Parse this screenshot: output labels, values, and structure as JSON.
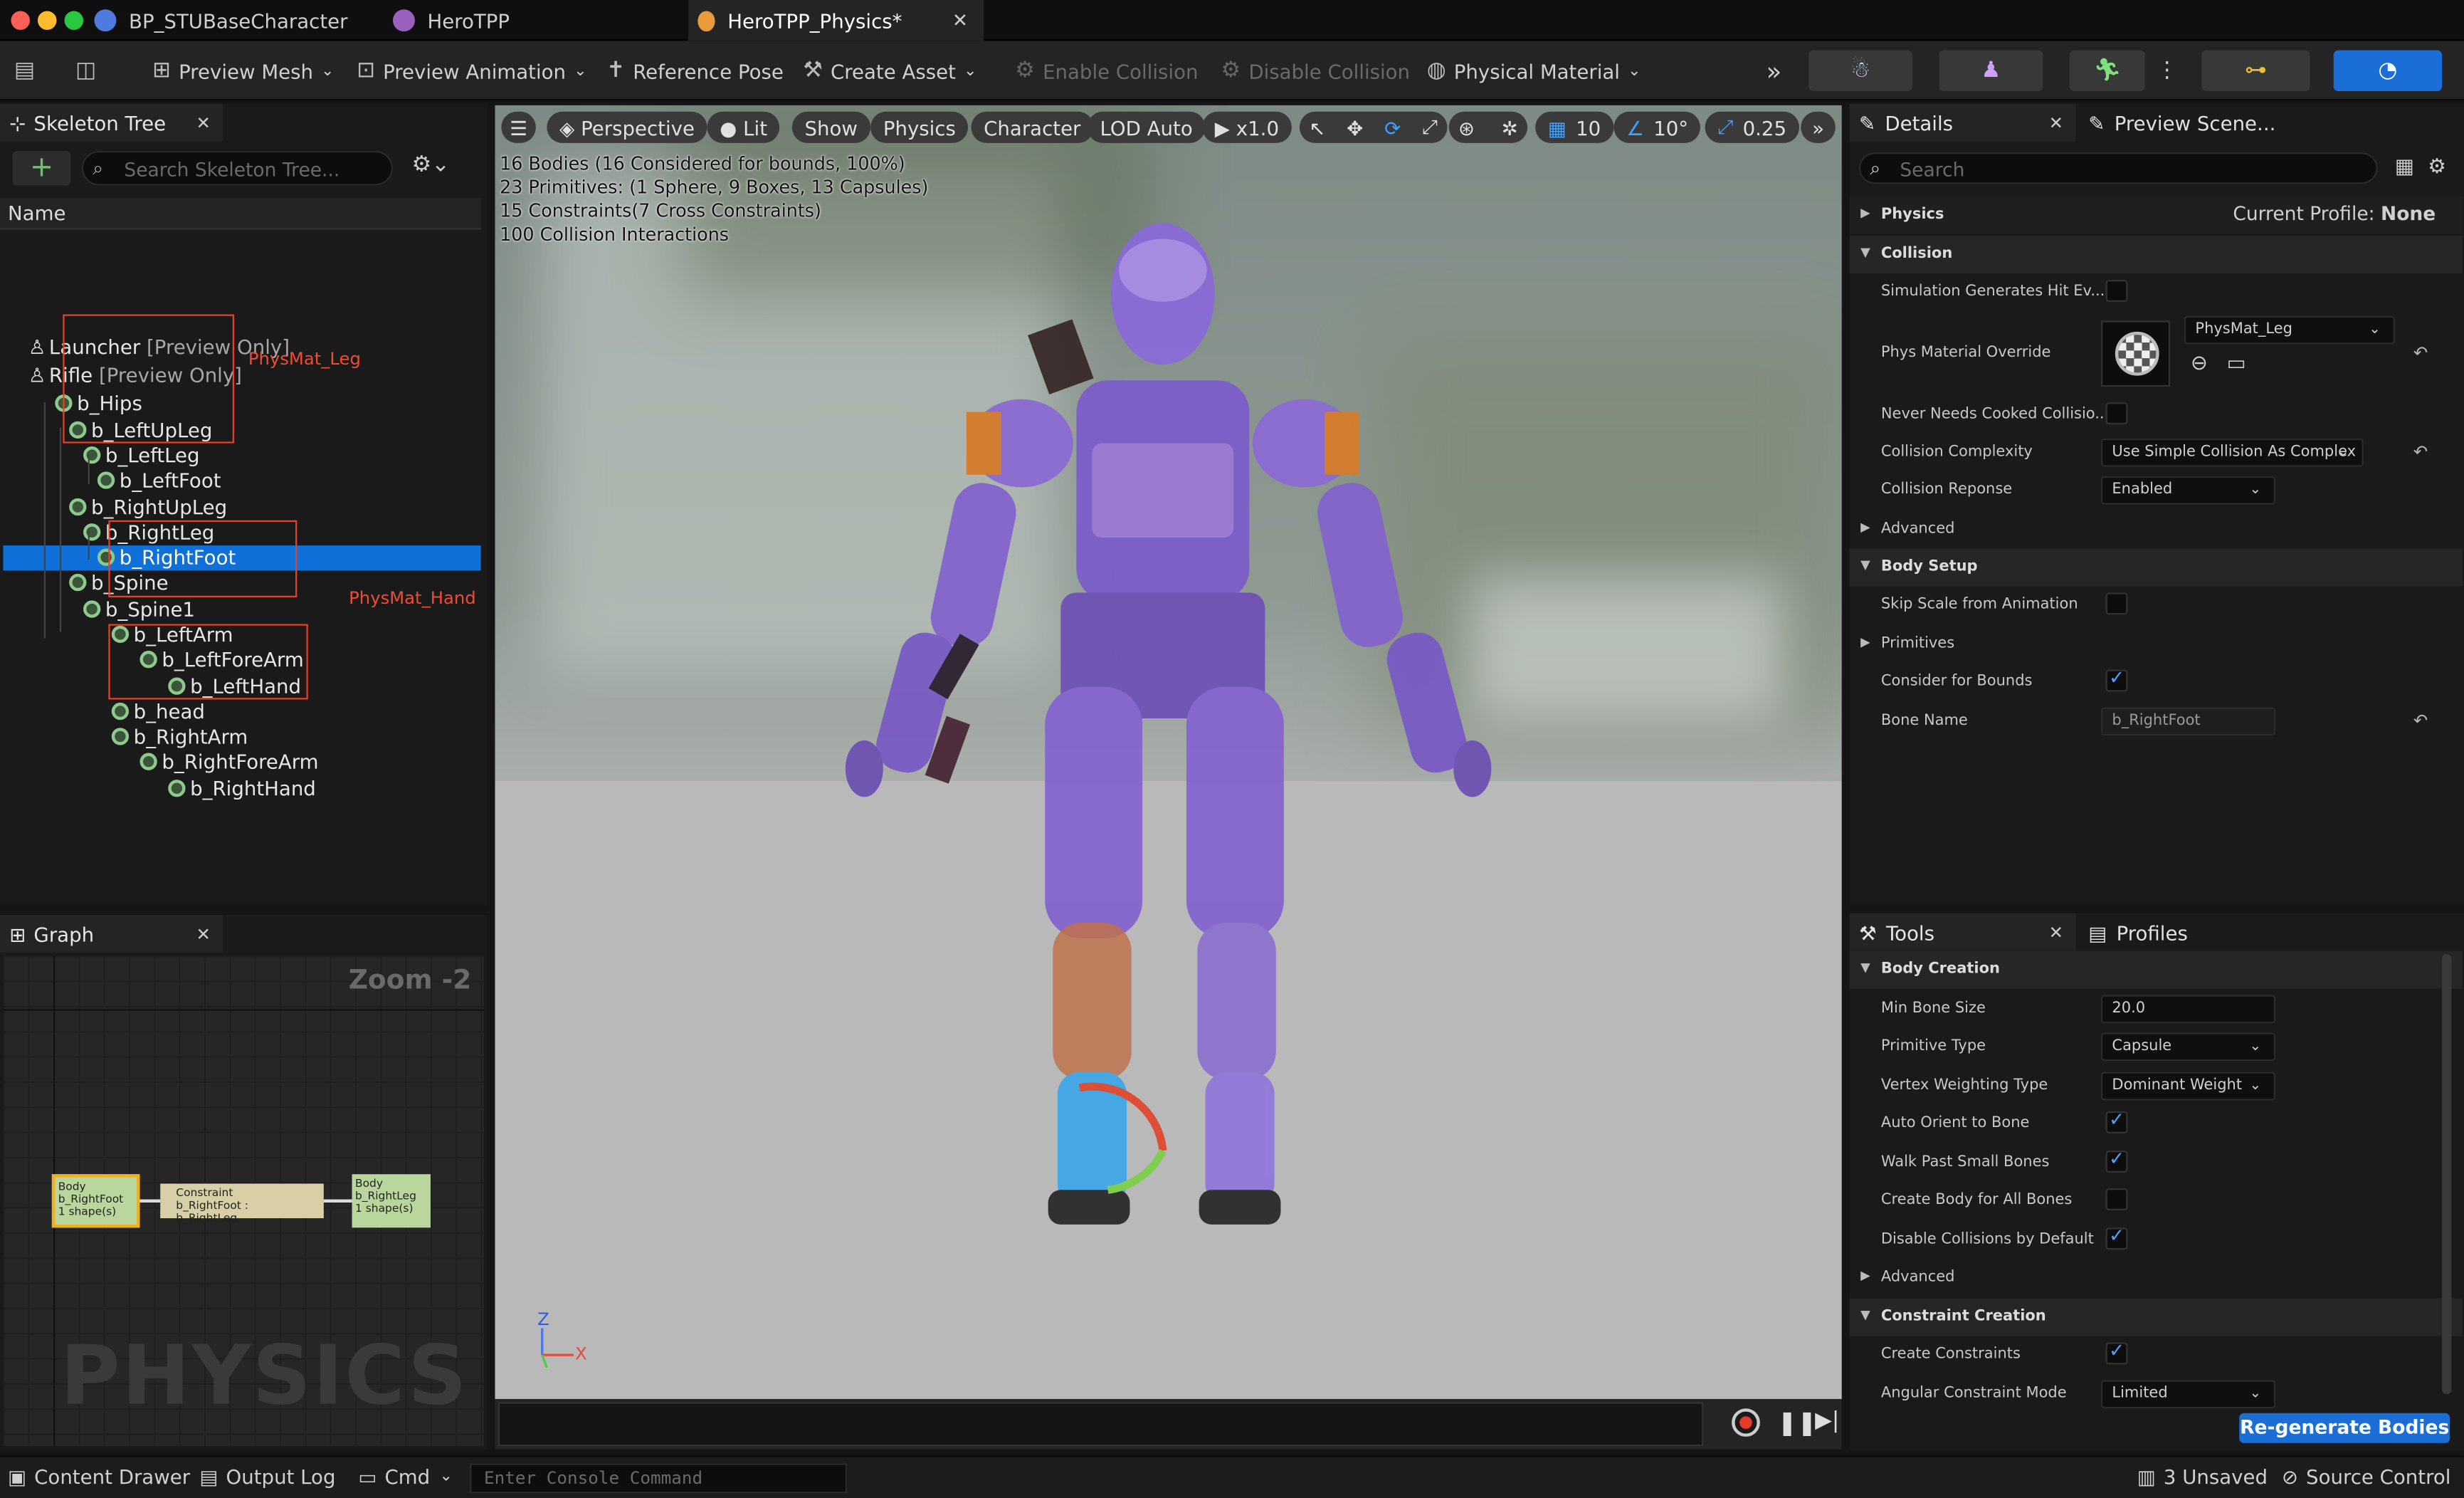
{
  "window": {
    "tabs": [
      {
        "label": "BP_STUBaseCharacter"
      },
      {
        "label": "HeroTPP"
      },
      {
        "label": "HeroTPP_Physics*"
      }
    ],
    "close_glyph": "✕"
  },
  "toolbar": {
    "preview_mesh": "Preview Mesh",
    "preview_animation": "Preview Animation",
    "reference_pose": "Reference Pose",
    "create_asset": "Create Asset",
    "enable_collision": "Enable Collision",
    "disable_collision": "Disable Collision",
    "physical_material": "Physical Material"
  },
  "skeleton_tree": {
    "title": "Skeleton Tree",
    "search_placeholder": "Search Skeleton Tree...",
    "column_name": "Name",
    "preview_only": "[Preview Only]",
    "rows": [
      {
        "label": "Launcher",
        "type": "socket",
        "suffix": "[Preview Only]"
      },
      {
        "label": "Rifle",
        "type": "socket",
        "suffix": "[Preview Only]"
      },
      {
        "label": "b_Hips"
      },
      {
        "label": "b_LeftUpLeg"
      },
      {
        "label": "b_LeftLeg"
      },
      {
        "label": "b_LeftFoot"
      },
      {
        "label": "b_RightUpLeg"
      },
      {
        "label": "b_RightLeg"
      },
      {
        "label": "b_RightFoot",
        "selected": true
      },
      {
        "label": "b_Spine"
      },
      {
        "label": "b_Spine1"
      },
      {
        "label": "b_LeftArm"
      },
      {
        "label": "b_LeftForeArm"
      },
      {
        "label": "b_LeftHand"
      },
      {
        "label": "b_head"
      },
      {
        "label": "b_RightArm"
      },
      {
        "label": "b_RightForeArm"
      },
      {
        "label": "b_RightHand"
      }
    ],
    "annotation_leg": "PhysMat_Leg",
    "annotation_hand": "PhysMat_Hand"
  },
  "graph": {
    "title": "Graph",
    "zoom": "Zoom -2",
    "watermark": "PHYSICS",
    "node_left": {
      "l1": "Body",
      "l2": "b_RightFoot",
      "l3": "1 shape(s)"
    },
    "node_mid": {
      "l1": "Constraint",
      "l2": "b_RightFoot : b_RightLeg"
    },
    "node_right": {
      "l1": "Body",
      "l2": "b_RightLeg",
      "l3": "1 shape(s)"
    }
  },
  "viewport": {
    "perspective": "Perspective",
    "lit": "Lit",
    "show": "Show",
    "physics": "Physics",
    "character": "Character",
    "lod": "LOD Auto",
    "speed": "x1.0",
    "grid": "10",
    "angle": "10°",
    "scale": "0.25",
    "stats": [
      "16 Bodies (16 Considered for bounds, 100%)",
      "23 Primitives: (1 Sphere, 9 Boxes, 13 Capsules)",
      "15 Constraints(7 Cross Constraints)",
      "100 Collision Interactions"
    ],
    "axis_z": "Z",
    "axis_x": "X"
  },
  "details": {
    "title": "Details",
    "preview_tab": "Preview Scene...",
    "search_placeholder": "Search",
    "physics_label": "Physics",
    "current_profile_label": "Current Profile:",
    "current_profile_value": "None",
    "collision_label": "Collision",
    "sim_hit_events": "Simulation Generates Hit Ev...",
    "phys_material_override": "Phys Material Override",
    "phys_material_value": "PhysMat_Leg",
    "never_cooked": "Never Needs Cooked Collisio...",
    "collision_complexity": "Collision Complexity",
    "collision_complexity_value": "Use Simple Collision As Complex",
    "collision_response": "Collision Reponse",
    "collision_response_value": "Enabled",
    "advanced": "Advanced",
    "body_setup": "Body Setup",
    "skip_scale": "Skip Scale from Animation",
    "primitives": "Primitives",
    "consider_bounds": "Consider for Bounds",
    "bone_name": "Bone Name",
    "bone_name_value": "b_RightFoot"
  },
  "tools": {
    "title": "Tools",
    "profiles_tab": "Profiles",
    "body_creation": "Body Creation",
    "min_bone_size": "Min Bone Size",
    "min_bone_size_value": "20.0",
    "primitive_type": "Primitive Type",
    "primitive_type_value": "Capsule",
    "vertex_weighting": "Vertex Weighting Type",
    "vertex_weighting_value": "Dominant Weight",
    "auto_orient": "Auto Orient to Bone",
    "walk_past": "Walk Past Small Bones",
    "create_body_all": "Create Body for All Bones",
    "disable_collisions": "Disable Collisions by Default",
    "advanced": "Advanced",
    "constraint_creation": "Constraint Creation",
    "create_constraints": "Create Constraints",
    "angular_mode": "Angular Constraint Mode",
    "angular_mode_value": "Limited",
    "regenerate": "Re-generate Bodies"
  },
  "statusbar": {
    "content_drawer": "Content Drawer",
    "output_log": "Output Log",
    "cmd": "Cmd",
    "console_placeholder": "Enter Console Command",
    "unsaved": "3 Unsaved",
    "source_control": "Source Control"
  },
  "colors": {
    "selection": "#0e70d8",
    "accent": "#1b6ed6",
    "annotation": "#e8412c"
  }
}
